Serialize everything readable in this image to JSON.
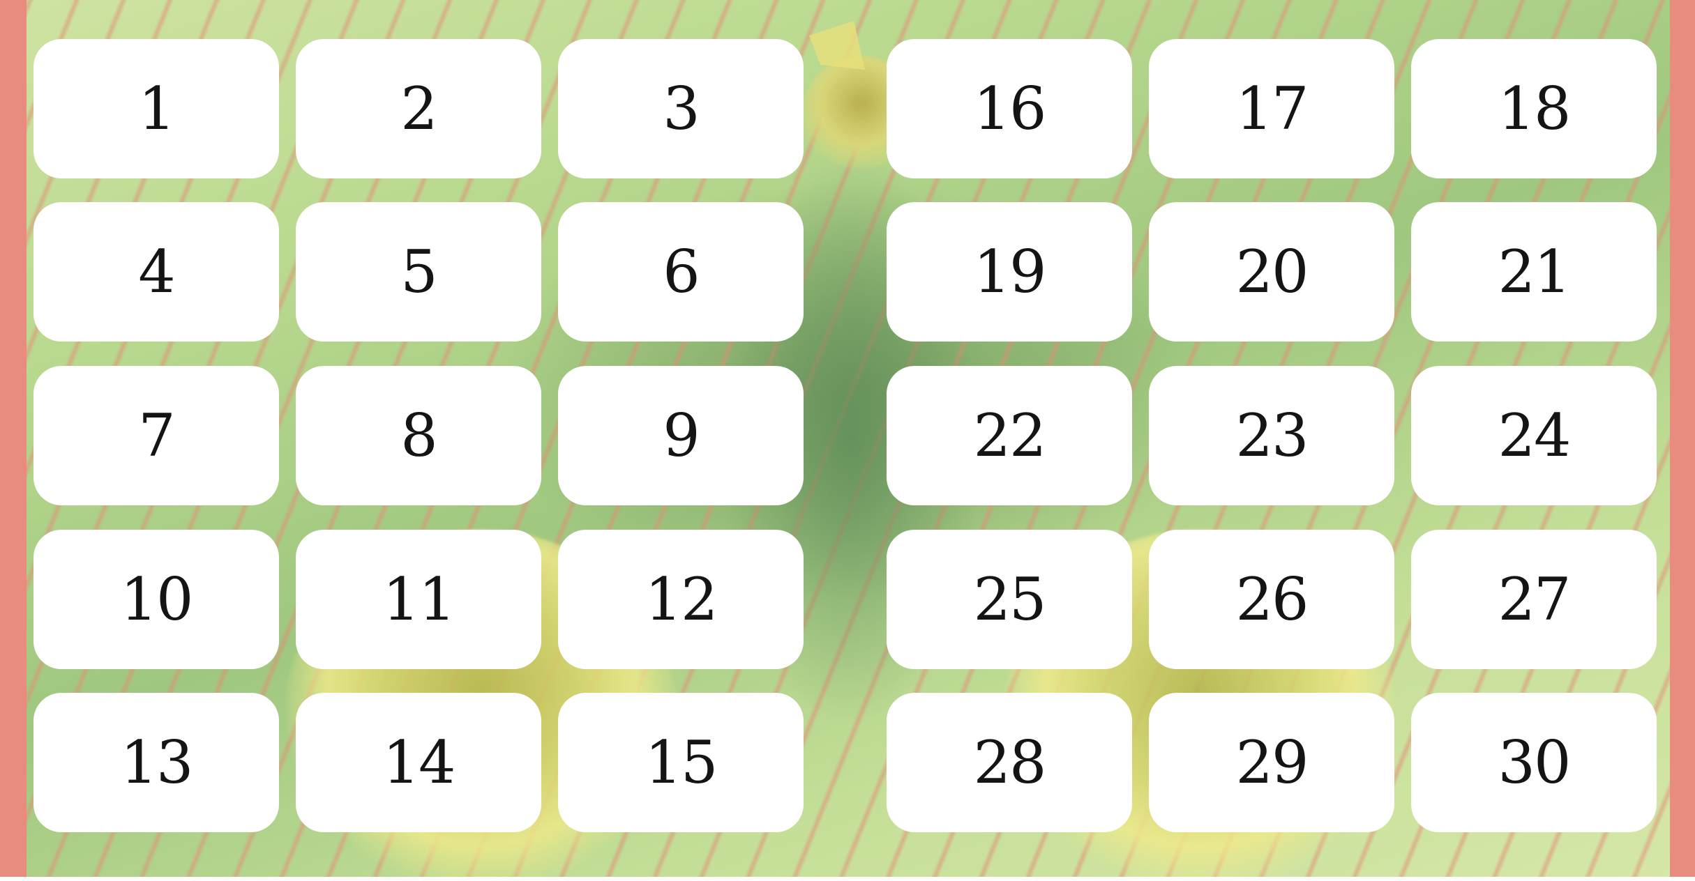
{
  "board": {
    "background_color": "#b9d98f",
    "border_color": "#e88c80",
    "tile_color": "#ffffff",
    "text_color": "#141414"
  },
  "tiles": [
    {
      "label": "1"
    },
    {
      "label": "2"
    },
    {
      "label": "3"
    },
    {
      "label": "4"
    },
    {
      "label": "5"
    },
    {
      "label": "6"
    },
    {
      "label": "7"
    },
    {
      "label": "8"
    },
    {
      "label": "9"
    },
    {
      "label": "10"
    },
    {
      "label": "11"
    },
    {
      "label": "12"
    },
    {
      "label": "13"
    },
    {
      "label": "14"
    },
    {
      "label": "15"
    },
    {
      "label": "16"
    },
    {
      "label": "17"
    },
    {
      "label": "18"
    },
    {
      "label": "19"
    },
    {
      "label": "20"
    },
    {
      "label": "21"
    },
    {
      "label": "22"
    },
    {
      "label": "23"
    },
    {
      "label": "24"
    },
    {
      "label": "25"
    },
    {
      "label": "26"
    },
    {
      "label": "27"
    },
    {
      "label": "28"
    },
    {
      "label": "29"
    },
    {
      "label": "30"
    }
  ]
}
